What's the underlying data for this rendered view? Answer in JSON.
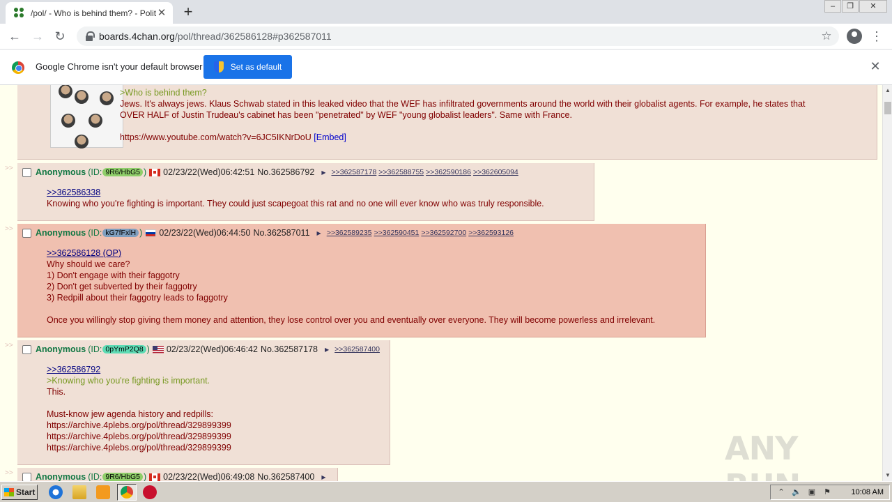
{
  "browser": {
    "tab_title": "/pol/ - Who is behind them? - Politica",
    "url_host": "boards.4chan.org",
    "url_path": "/pol/thread/362586128#p362587011",
    "infobar_text": "Google Chrome isn't your default browser",
    "set_default_label": "Set as default"
  },
  "posts": {
    "op_tail": {
      "lines": [
        ">Who is behind them?",
        "Jews. It's always jews. Klaus Schwab stated in this leaked video that the WEF has infiltrated governments around the world with their globalist agents. For example, he states that",
        "OVER HALF of Justin Trudeau's cabinet has been \"penetrated\" by WEF \"young globalist leaders\". Same with France.",
        "https://www.youtube.com/watch?v=6JC5IKNrDoU",
        "[Embed]"
      ]
    },
    "p1": {
      "name": "Anonymous",
      "id_prefix": "(ID:",
      "id": "9R6/HbG5",
      "id_suffix": ")",
      "datetime": "02/23/22(Wed)06:42:51",
      "number": "No.362586792",
      "backlinks": [
        ">>362587178",
        ">>362588755",
        ">>362590186",
        ">>362605094"
      ],
      "quote": ">>362586338",
      "text": "Knowing who you're fighting is important. They could just scapegoat this rat and no one will ever know who was truly responsible."
    },
    "p2": {
      "name": "Anonymous",
      "id_prefix": "(ID:",
      "id": "kG7fFxlH",
      "id_suffix": ")",
      "datetime": "02/23/22(Wed)06:44:50",
      "number": "No.362587011",
      "backlinks": [
        ">>362589235",
        ">>362590451",
        ">>362592700",
        ">>362593126"
      ],
      "quote": ">>362586128 (OP)",
      "lines": [
        "Why should we care?",
        "1) Don't engage with their faggotry",
        "2) Don't get subverted by their faggotry",
        "3) Redpill about their faggotry leads to faggotry",
        "Once you willingly stop giving them money and attention, they lose control over you and eventually over everyone. They will become powerless and irrelevant."
      ]
    },
    "p3": {
      "name": "Anonymous",
      "id_prefix": "(ID:",
      "id": "0pYmP2Q8",
      "id_suffix": ")",
      "datetime": "02/23/22(Wed)06:46:42",
      "number": "No.362587178",
      "backlinks": [
        ">>362587400"
      ],
      "quote": ">>362586792",
      "greentext": ">Knowing who you're fighting is important.",
      "lines": [
        "This.",
        "Must-know jew agenda history and redpills:",
        "https://archive.4plebs.org/pol/thread/329899399",
        "https://archive.4plebs.org/pol/thread/329899399",
        "https://archive.4plebs.org/pol/thread/329899399"
      ]
    },
    "p4": {
      "name": "Anonymous",
      "id_prefix": "(ID:",
      "id": "9R6/HbG5",
      "id_suffix": ")",
      "datetime": "02/23/22(Wed)06:49:08",
      "number": "No.362587400"
    }
  },
  "side_arrow": ">>",
  "watermark": "ANY RUN",
  "taskbar": {
    "start_label": "Start",
    "clock": "10:08 AM"
  },
  "colors": {
    "id_9R6": "#8fce6a",
    "id_kG7": "#7f9fbf",
    "id_0pY": "#5ddbb4"
  }
}
